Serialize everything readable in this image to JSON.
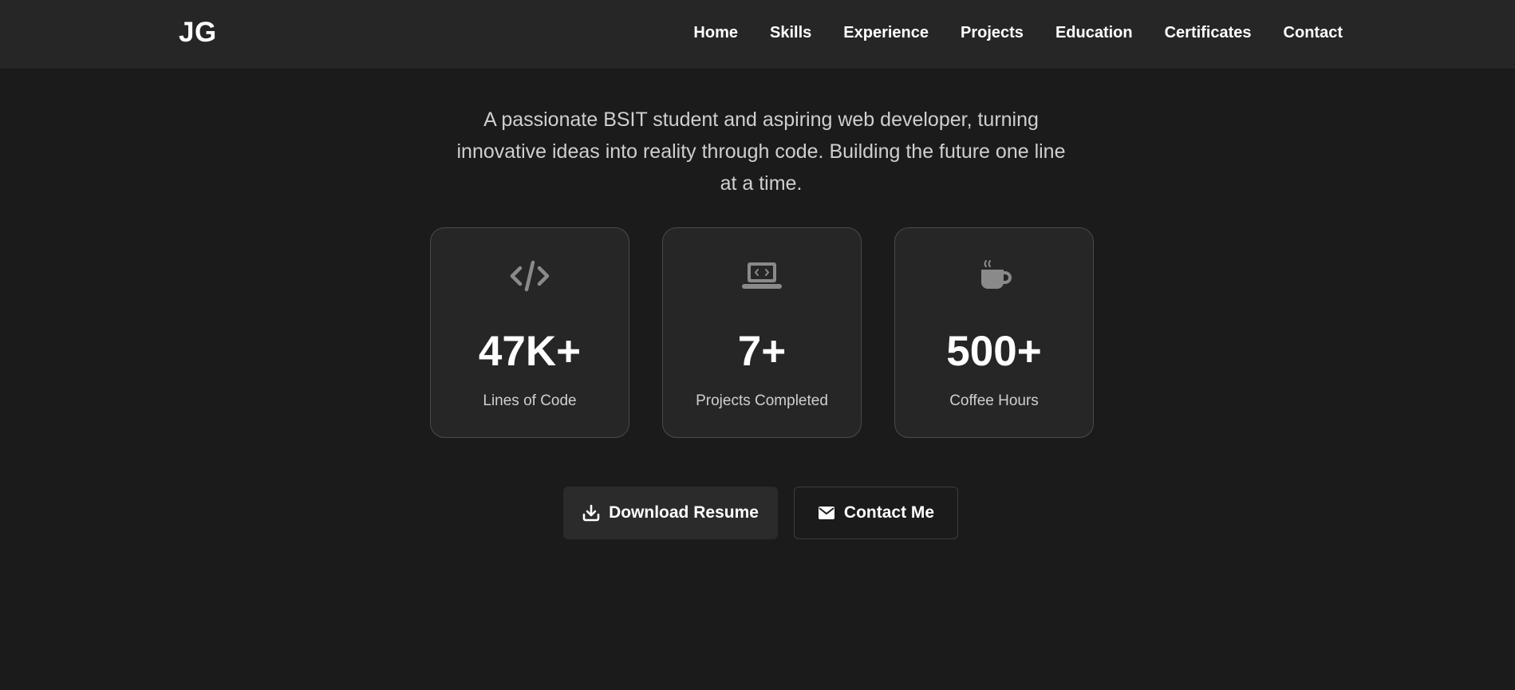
{
  "header": {
    "logo": "JG",
    "nav": [
      "Home",
      "Skills",
      "Experience",
      "Projects",
      "Education",
      "Certificates",
      "Contact"
    ]
  },
  "hero": {
    "tagline": "A passionate BSIT student and aspiring web developer, turning innovative ideas into reality through code. Building the future one line at a time."
  },
  "stats": [
    {
      "icon": "code-icon",
      "value": "47K+",
      "label": "Lines of Code"
    },
    {
      "icon": "laptop-code-icon",
      "value": "7+",
      "label": "Projects Completed"
    },
    {
      "icon": "coffee-icon",
      "value": "500+",
      "label": "Coffee Hours"
    }
  ],
  "actions": {
    "download_label": "Download Resume",
    "download_icon": "download-icon",
    "contact_label": "Contact Me",
    "contact_icon": "envelope-icon"
  },
  "colors": {
    "background": "#1b1b1b",
    "header": "#262626",
    "card": "#262626",
    "icon": "#8a8a8a",
    "text_muted": "#cfcfcf"
  }
}
